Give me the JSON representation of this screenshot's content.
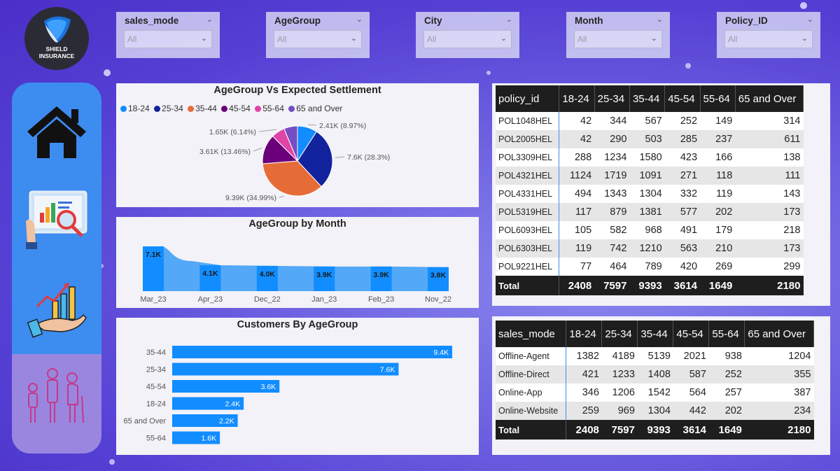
{
  "logo": {
    "line1": "SHIELD",
    "line2": "INSURANCE"
  },
  "slicers": [
    {
      "title": "sales_mode",
      "value": "All"
    },
    {
      "title": "AgeGroup",
      "value": "All"
    },
    {
      "title": "City",
      "value": "All"
    },
    {
      "title": "Month",
      "value": "All"
    },
    {
      "title": "Policy_ID",
      "value": "All"
    }
  ],
  "nav": [
    {
      "name": "home",
      "icon": "home-icon"
    },
    {
      "name": "analysis",
      "icon": "dashboard-analysis-icon"
    },
    {
      "name": "growth",
      "icon": "growth-chart-icon"
    },
    {
      "name": "age-groups",
      "icon": "people-age-groups-icon",
      "active": true
    }
  ],
  "colors": {
    "sidebar": "#3d8cf0",
    "accent": "#118dff",
    "area_fill": "#4aa3f7"
  },
  "pie": {
    "title": "AgeGroup Vs Expected Settlement",
    "legend": [
      "18-24",
      "25-34",
      "35-44",
      "45-54",
      "55-64",
      "65 and Over"
    ],
    "chart_data": {
      "type": "pie",
      "title": "AgeGroup Vs Expected Settlement",
      "categories": [
        "18-24",
        "25-34",
        "35-44",
        "45-54",
        "55-64",
        "65 and Over"
      ],
      "values": [
        2.41,
        7.6,
        9.39,
        3.61,
        1.65,
        1.65
      ],
      "percents": [
        8.97,
        28.3,
        34.99,
        13.46,
        6.14,
        6.14
      ],
      "colors": [
        "#118dff",
        "#12239e",
        "#e66c37",
        "#6b007b",
        "#e044a7",
        "#744ec2"
      ],
      "labels": [
        "2.41K (8.97%)",
        "7.6K (28.3%)",
        "9.39K (34.99%)",
        "3.61K (13.46%)",
        "1.65K (6.14%)",
        ""
      ]
    }
  },
  "month": {
    "title": "AgeGroup by Month",
    "chart_data": {
      "type": "area",
      "title": "AgeGroup by Month",
      "categories": [
        "Mar_23",
        "Apr_23",
        "Dec_22",
        "Jan_23",
        "Feb_23",
        "Nov_22"
      ],
      "values": [
        7.1,
        4.1,
        4.0,
        3.9,
        3.9,
        3.8
      ],
      "labels": [
        "7.1K",
        "4.1K",
        "4.0K",
        "3.9K",
        "3.9K",
        "3.8K"
      ]
    }
  },
  "customers": {
    "title": "Customers By AgeGroup",
    "chart_data": {
      "type": "bar",
      "orientation": "horizontal",
      "title": "Customers By AgeGroup",
      "categories": [
        "35-44",
        "25-34",
        "45-54",
        "18-24",
        "65 and Over",
        "55-64"
      ],
      "values": [
        9.4,
        7.6,
        3.6,
        2.4,
        2.2,
        1.6
      ],
      "labels": [
        "9.4K",
        "7.6K",
        "3.6K",
        "2.4K",
        "2.2K",
        "1.6K"
      ],
      "color": "#118dff"
    }
  },
  "policy_table": {
    "headers": [
      "policy_id",
      "18-24",
      "25-34",
      "35-44",
      "45-54",
      "55-64",
      "65 and Over"
    ],
    "rows": [
      [
        "POL1048HEL",
        "42",
        "344",
        "567",
        "252",
        "149",
        "314"
      ],
      [
        "POL2005HEL",
        "42",
        "290",
        "503",
        "285",
        "237",
        "611"
      ],
      [
        "POL3309HEL",
        "288",
        "1234",
        "1580",
        "423",
        "166",
        "138"
      ],
      [
        "POL4321HEL",
        "1124",
        "1719",
        "1091",
        "271",
        "118",
        "111"
      ],
      [
        "POL4331HEL",
        "494",
        "1343",
        "1304",
        "332",
        "119",
        "143"
      ],
      [
        "POL5319HEL",
        "117",
        "879",
        "1381",
        "577",
        "202",
        "173"
      ],
      [
        "POL6093HEL",
        "105",
        "582",
        "968",
        "491",
        "179",
        "218"
      ],
      [
        "POL6303HEL",
        "119",
        "742",
        "1210",
        "563",
        "210",
        "173"
      ],
      [
        "POL9221HEL",
        "77",
        "464",
        "789",
        "420",
        "269",
        "299"
      ]
    ],
    "total": [
      "Total",
      "2408",
      "7597",
      "9393",
      "3614",
      "1649",
      "2180"
    ]
  },
  "sales_table": {
    "headers": [
      "sales_mode",
      "18-24",
      "25-34",
      "35-44",
      "45-54",
      "55-64",
      "65 and Over"
    ],
    "rows": [
      [
        "Offline-Agent",
        "1382",
        "4189",
        "5139",
        "2021",
        "938",
        "1204"
      ],
      [
        "Offline-Direct",
        "421",
        "1233",
        "1408",
        "587",
        "252",
        "355"
      ],
      [
        "Online-App",
        "346",
        "1206",
        "1542",
        "564",
        "257",
        "387"
      ],
      [
        "Online-Website",
        "259",
        "969",
        "1304",
        "442",
        "202",
        "234"
      ]
    ],
    "total": [
      "Total",
      "2408",
      "7597",
      "9393",
      "3614",
      "1649",
      "2180"
    ]
  }
}
